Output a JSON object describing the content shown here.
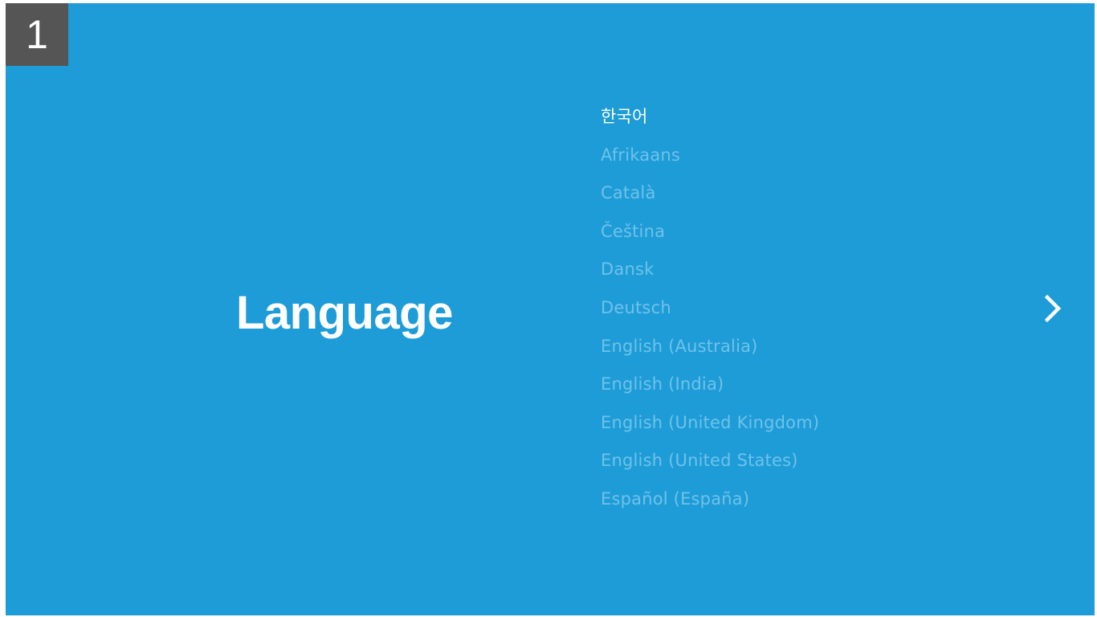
{
  "step": {
    "number": "1"
  },
  "page": {
    "title": "Language"
  },
  "languages": [
    {
      "label": "한국어",
      "selected": true
    },
    {
      "label": "Afrikaans",
      "selected": false
    },
    {
      "label": "Català",
      "selected": false
    },
    {
      "label": "Čeština",
      "selected": false
    },
    {
      "label": "Dansk",
      "selected": false
    },
    {
      "label": "Deutsch",
      "selected": false
    },
    {
      "label": "English (Australia)",
      "selected": false
    },
    {
      "label": "English (India)",
      "selected": false
    },
    {
      "label": "English (United Kingdom)",
      "selected": false
    },
    {
      "label": "English (United States)",
      "selected": false
    },
    {
      "label": "Español (España)",
      "selected": false
    }
  ],
  "navigation": {
    "next_icon": "chevron-right-icon"
  },
  "colors": {
    "background": "#1e9cd7",
    "badge": "#555555",
    "selected_text": "#ffffff",
    "unselected_text": "#6fc2ea"
  }
}
